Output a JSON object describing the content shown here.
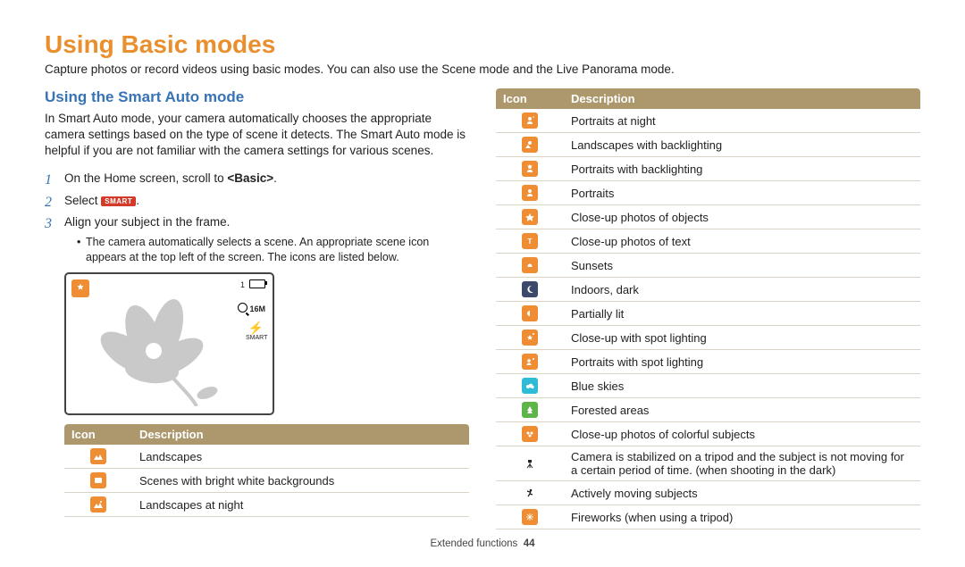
{
  "title": "Using Basic modes",
  "lead": "Capture photos or record videos using basic modes. You can also use the Scene mode and the Live Panorama mode.",
  "section_title": "Using the Smart Auto mode",
  "intro": "In Smart Auto mode, your camera automatically chooses the appropriate camera settings based on the type of scene it detects. The Smart Auto mode is helpful if you are not familiar with the camera settings for various scenes.",
  "steps": {
    "s1_pre": "On the Home screen, scroll to ",
    "s1_bold": "<Basic>",
    "s1_post": ".",
    "s2_pre": "Select ",
    "s2_icon": "SMART",
    "s2_post": ".",
    "s3": "Align your subject in the frame.",
    "s3_sub": "The camera automatically selects a scene. An appropriate scene icon appears at the top left of the screen. The icons are listed below."
  },
  "screen_overlay": {
    "shots": "1",
    "size": "16M",
    "smart_label": "SMART"
  },
  "table_headers": {
    "icon": "Icon",
    "desc": "Description"
  },
  "left_table": [
    {
      "label": "Landscapes"
    },
    {
      "label": "Scenes with bright white backgrounds"
    },
    {
      "label": "Landscapes at night"
    }
  ],
  "right_table": [
    {
      "label": "Portraits at night"
    },
    {
      "label": "Landscapes with backlighting"
    },
    {
      "label": "Portraits with backlighting"
    },
    {
      "label": "Portraits"
    },
    {
      "label": "Close-up photos of objects"
    },
    {
      "label": "Close-up photos of text"
    },
    {
      "label": "Sunsets"
    },
    {
      "label": "Indoors, dark"
    },
    {
      "label": "Partially lit"
    },
    {
      "label": "Close-up with spot lighting"
    },
    {
      "label": "Portraits with spot lighting"
    },
    {
      "label": "Blue skies"
    },
    {
      "label": "Forested areas"
    },
    {
      "label": "Close-up photos of colorful subjects"
    },
    {
      "label": "Camera is stabilized on a tripod and the subject is not moving for a certain period of time. (when shooting in the dark)"
    },
    {
      "label": "Actively moving subjects"
    },
    {
      "label": "Fireworks (when using a tripod)"
    }
  ],
  "footer": {
    "section": "Extended functions",
    "page": "44"
  }
}
